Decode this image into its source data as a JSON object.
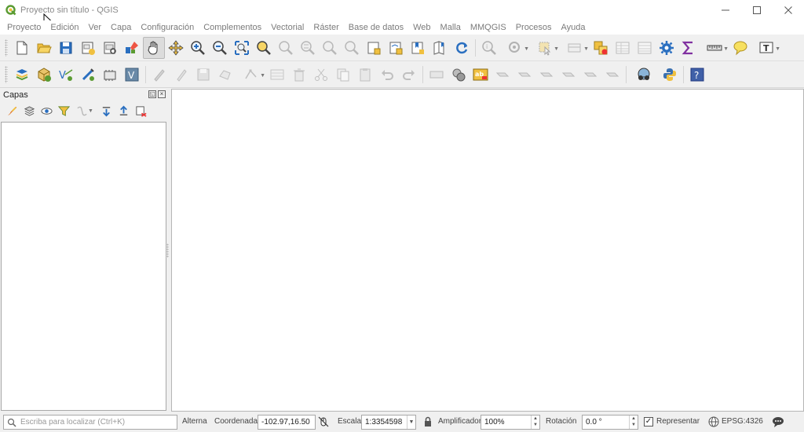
{
  "window": {
    "title": "Proyecto sin título - QGIS",
    "minimize_icon": "minimize-icon",
    "maximize_icon": "maximize-icon",
    "close_icon": "close-icon"
  },
  "menu": [
    "Proyecto",
    "Edición",
    "Ver",
    "Capa",
    "Configuración",
    "Complementos",
    "Vectorial",
    "Ráster",
    "Base de datos",
    "Web",
    "Malla",
    "MMQGIS",
    "Procesos",
    "Ayuda"
  ],
  "toolbar1": [
    "new-project-icon",
    "open-project-icon",
    "save-project-icon",
    "new-print-layout-icon",
    "layout-manager-icon",
    "style-manager-icon",
    "pan-icon",
    "pan-to-selection-icon",
    "zoom-in-icon",
    "zoom-out-icon",
    "zoom-full-icon",
    "zoom-to-selection-icon",
    "zoom-to-layer-icon",
    "zoom-native-icon",
    "zoom-last-icon",
    "zoom-next-icon",
    "new-map-view-icon",
    "new-3d-view-icon",
    "new-bookmark-icon",
    "show-bookmarks-icon",
    "refresh-icon",
    "identify-icon",
    "run-action-icon",
    "select-features-icon",
    "select-by-value-icon",
    "deselect-icon",
    "attribute-table-icon",
    "field-calculator-icon",
    "processing-toolbox-icon",
    "statistics-icon",
    "measure-icon",
    "map-tips-icon",
    "text-annotation-icon"
  ],
  "toolbar2": [
    "data-source-manager-icon",
    "new-geopackage-layer-icon",
    "new-shapefile-layer-icon",
    "new-spatialite-layer-icon",
    "new-temporary-layer-icon",
    "new-virtual-layer-icon",
    "current-edits-icon",
    "toggle-editing-icon",
    "save-edits-icon",
    "add-feature-icon",
    "vertex-tool-icon",
    "modify-attributes-icon",
    "delete-selected-icon",
    "cut-features-icon",
    "copy-features-icon",
    "paste-features-icon",
    "undo-icon",
    "redo-icon",
    "label-toolbar-icon",
    "layer-labeling-icon",
    "diagram-icon",
    "highlight-pinned-icon",
    "pin-unpin-labels-icon",
    "show-hide-labels-icon",
    "move-label-icon",
    "rotate-label-icon",
    "change-label-icon",
    "geocoder-icon",
    "python-console-icon",
    "help-icon"
  ],
  "layers_panel": {
    "title": "Capas",
    "tools": [
      "open-layer-styling-icon",
      "add-group-icon",
      "manage-map-themes-icon",
      "filter-legend-icon",
      "filter-by-expression-icon",
      "expand-all-icon",
      "collapse-all-icon",
      "remove-layer-icon"
    ]
  },
  "status": {
    "locator_placeholder": "Escriba para localizar (Ctrl+K)",
    "toggle_label": "Alterna",
    "coordinate_label": "Coordenada",
    "coordinate_value": "-102.97,16.50",
    "scale_label": "Escala",
    "scale_value": "1:3354598",
    "magnifier_label": "Amplificador",
    "magnifier_value": "100%",
    "rotation_label": "Rotación",
    "rotation_value": "0.0 °",
    "render_label": "Representar",
    "render_checked": true,
    "crs": "EPSG:4326"
  },
  "colors": {
    "qgis_green": "#5a9b32",
    "folder_yellow": "#f0c040",
    "blue": "#2a6fc0",
    "help_blue": "#4060a8"
  }
}
